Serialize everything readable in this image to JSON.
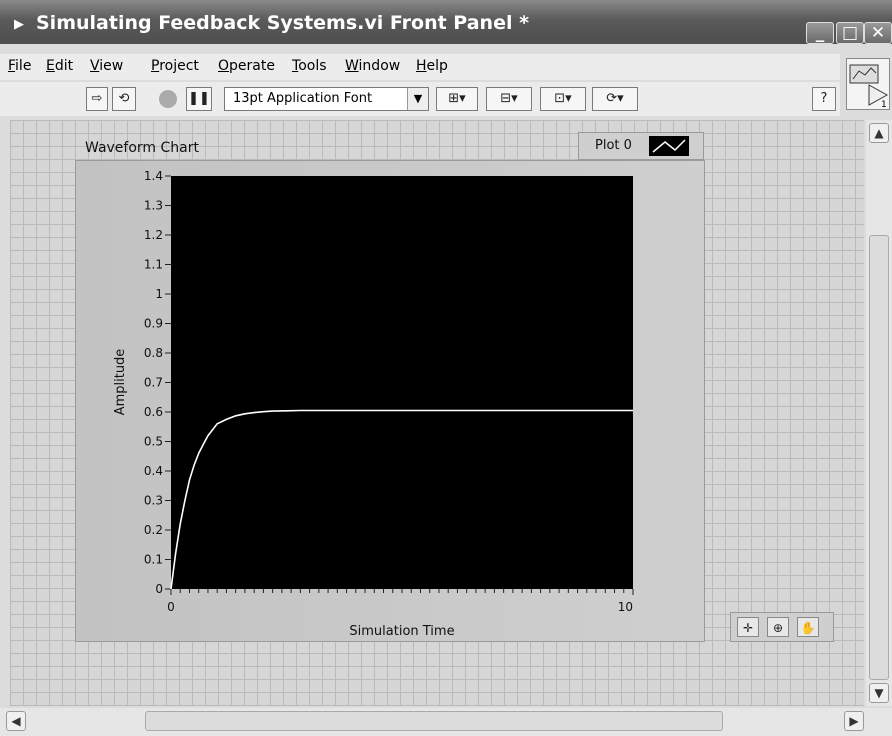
{
  "window": {
    "title": "Simulating Feedback Systems.vi Front Panel *",
    "controls": {
      "minimize": "_",
      "maximize": "□",
      "close": "✕"
    }
  },
  "menu": [
    {
      "label": "File",
      "underline": "F",
      "rest": "ile"
    },
    {
      "label": "Edit",
      "underline": "E",
      "rest": "dit"
    },
    {
      "label": "View",
      "underline": "V",
      "rest": "iew"
    },
    {
      "label": "Project",
      "underline": "P",
      "rest": "roject"
    },
    {
      "label": "Operate",
      "underline": "O",
      "rest": "perate"
    },
    {
      "label": "Tools",
      "underline": "T",
      "rest": "ools"
    },
    {
      "label": "Window",
      "underline": "W",
      "rest": "indow"
    },
    {
      "label": "Help",
      "underline": "H",
      "rest": "elp"
    }
  ],
  "toolbar": {
    "font_select": "13pt Application Font",
    "icons": [
      "run-arrow-icon",
      "run-continuously-icon",
      "abort-icon",
      "pause-icon",
      "align-objects-icon",
      "distribute-objects-icon",
      "resize-objects-icon",
      "reorder-icon",
      "help-icon"
    ]
  },
  "chart": {
    "label": "Waveform Chart",
    "legend_plot": "Plot 0",
    "palette_icons": [
      "cursor-icon",
      "zoom-icon",
      "pan-hand-icon"
    ]
  },
  "chart_data": {
    "type": "line",
    "title": "Waveform Chart",
    "xlabel": "Simulation Time",
    "ylabel": "Amplitude",
    "xlim": [
      0,
      10
    ],
    "ylim": [
      0,
      1.4
    ],
    "x_ticks": [
      "0",
      "10"
    ],
    "y_ticks": [
      "0",
      "0.1",
      "0.2",
      "0.3",
      "0.4",
      "0.5",
      "0.6",
      "0.7",
      "0.8",
      "0.9",
      "1",
      "1.1",
      "1.2",
      "1.3",
      "1.4"
    ],
    "grid": false,
    "background": "#000000",
    "line_color": "#ffffff",
    "series": [
      {
        "name": "Plot 0",
        "x": [
          0,
          0.1,
          0.2,
          0.3,
          0.4,
          0.5,
          0.6,
          0.7,
          0.8,
          0.9,
          1.0,
          1.2,
          1.4,
          1.6,
          1.8,
          2.0,
          2.2,
          2.5,
          2.8,
          3.2,
          3.6,
          4.0,
          5.0,
          6.0,
          7.0,
          8.0,
          9.0,
          10.0
        ],
        "y": [
          0,
          0.12,
          0.22,
          0.3,
          0.37,
          0.42,
          0.46,
          0.49,
          0.52,
          0.54,
          0.56,
          0.575,
          0.587,
          0.594,
          0.598,
          0.601,
          0.603,
          0.604,
          0.605,
          0.605,
          0.605,
          0.605,
          0.605,
          0.605,
          0.605,
          0.605,
          0.605,
          0.605
        ]
      }
    ]
  },
  "colors": {
    "panel_bg": "#d6d6d6",
    "grid": "#b9b9b9",
    "plot_bg": "#000000",
    "trace": "#ffffff"
  }
}
